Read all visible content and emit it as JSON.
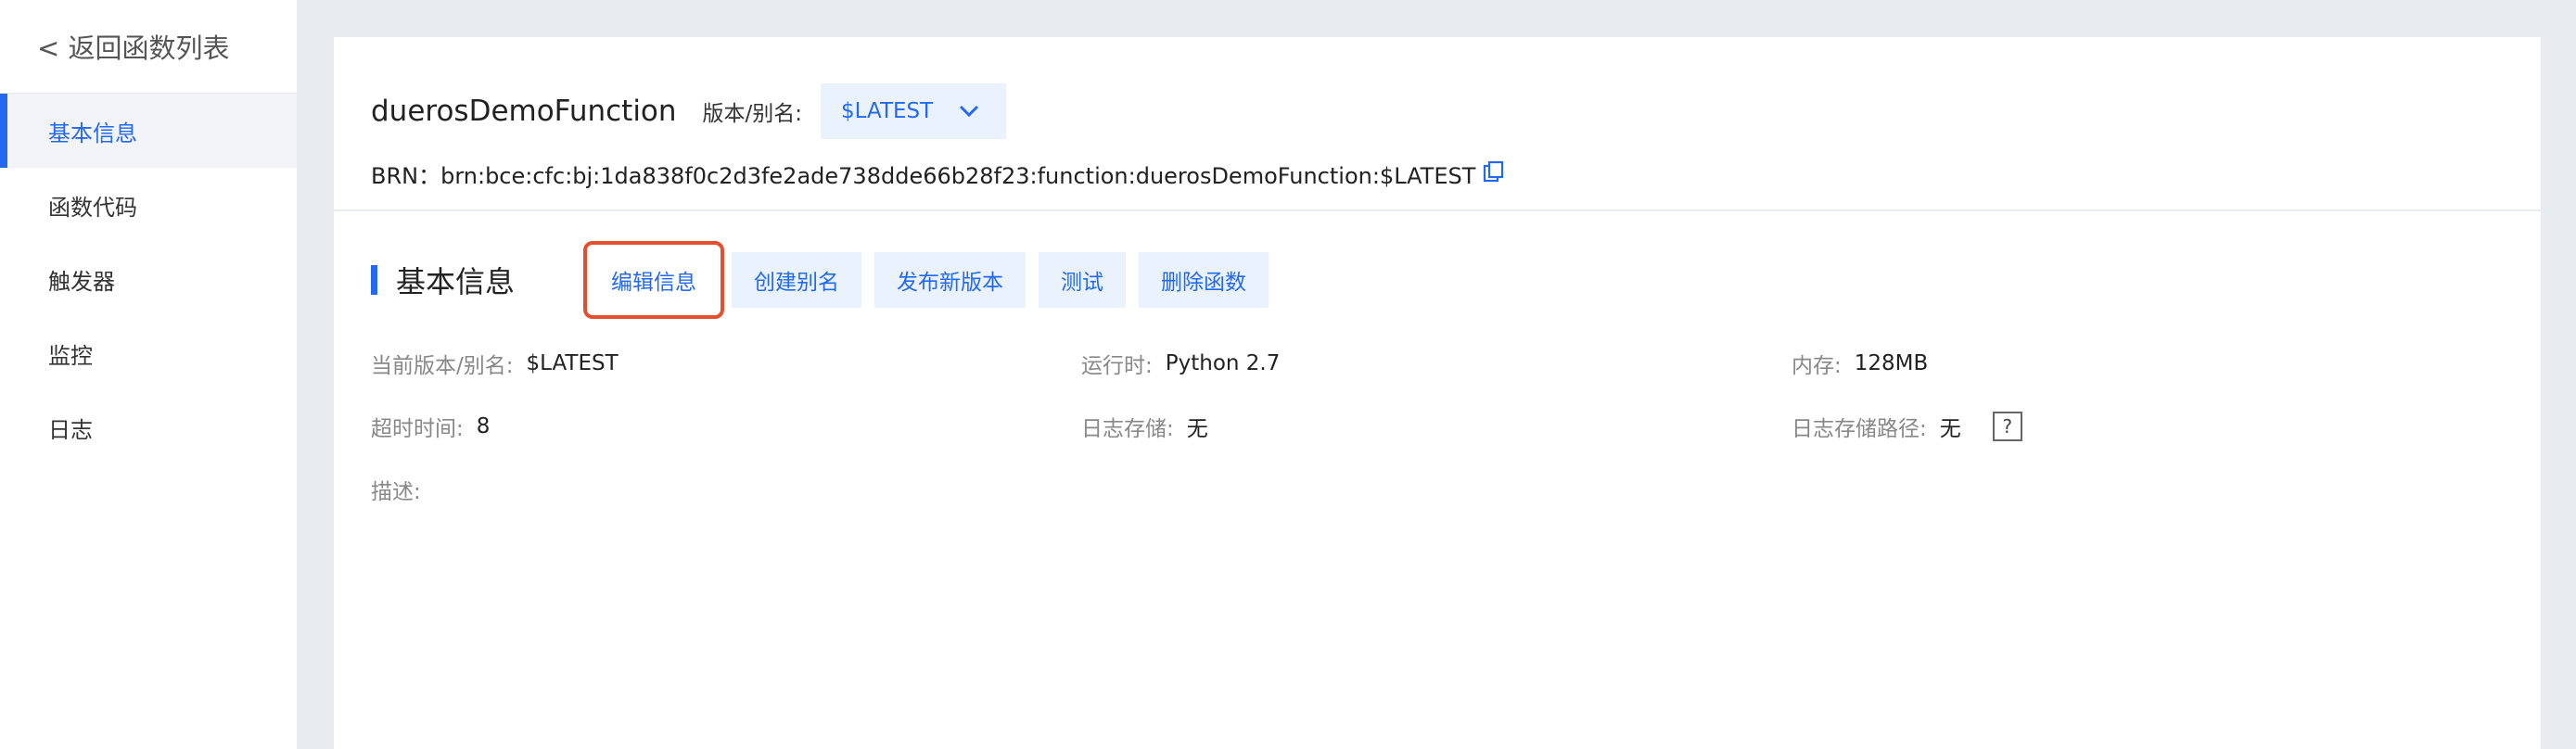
{
  "sidebar": {
    "back_label": "< 返回函数列表",
    "items": [
      {
        "label": "基本信息",
        "active": true
      },
      {
        "label": "函数代码"
      },
      {
        "label": "触发器"
      },
      {
        "label": "监控"
      },
      {
        "label": "日志"
      }
    ]
  },
  "header": {
    "function_name": "duerosDemoFunction",
    "version_label": "版本/别名:",
    "version_value": "$LATEST",
    "brn": "BRN：brn:bce:cfc:bj:1da838f0c2d3fe2ade738dde66b28f23:function:duerosDemoFunction:$LATEST"
  },
  "section": {
    "title": "基本信息",
    "buttons": {
      "edit": "编辑信息",
      "create_alias": "创建别名",
      "publish": "发布新版本",
      "test": "测试",
      "delete": "删除函数"
    }
  },
  "info": {
    "current_version_label": "当前版本/别名:",
    "current_version_value": "$LATEST",
    "runtime_label": "运行时:",
    "runtime_value": "Python 2.7",
    "memory_label": "内存:",
    "memory_value": "128MB",
    "timeout_label": "超时时间:",
    "timeout_value": "8",
    "log_storage_label": "日志存储:",
    "log_storage_value": "无",
    "log_path_label": "日志存储路径:",
    "log_path_value": "无",
    "help_glyph": "?",
    "description_label": "描述:"
  },
  "colors": {
    "accent": "#2468f2",
    "button_bg": "#eaf3fd",
    "highlight_border": "#e4502e",
    "page_bg": "#e8ecf1"
  },
  "icons": {
    "chevron": "chevron-down-icon",
    "copy": "copy-icon",
    "help": "help-icon"
  }
}
